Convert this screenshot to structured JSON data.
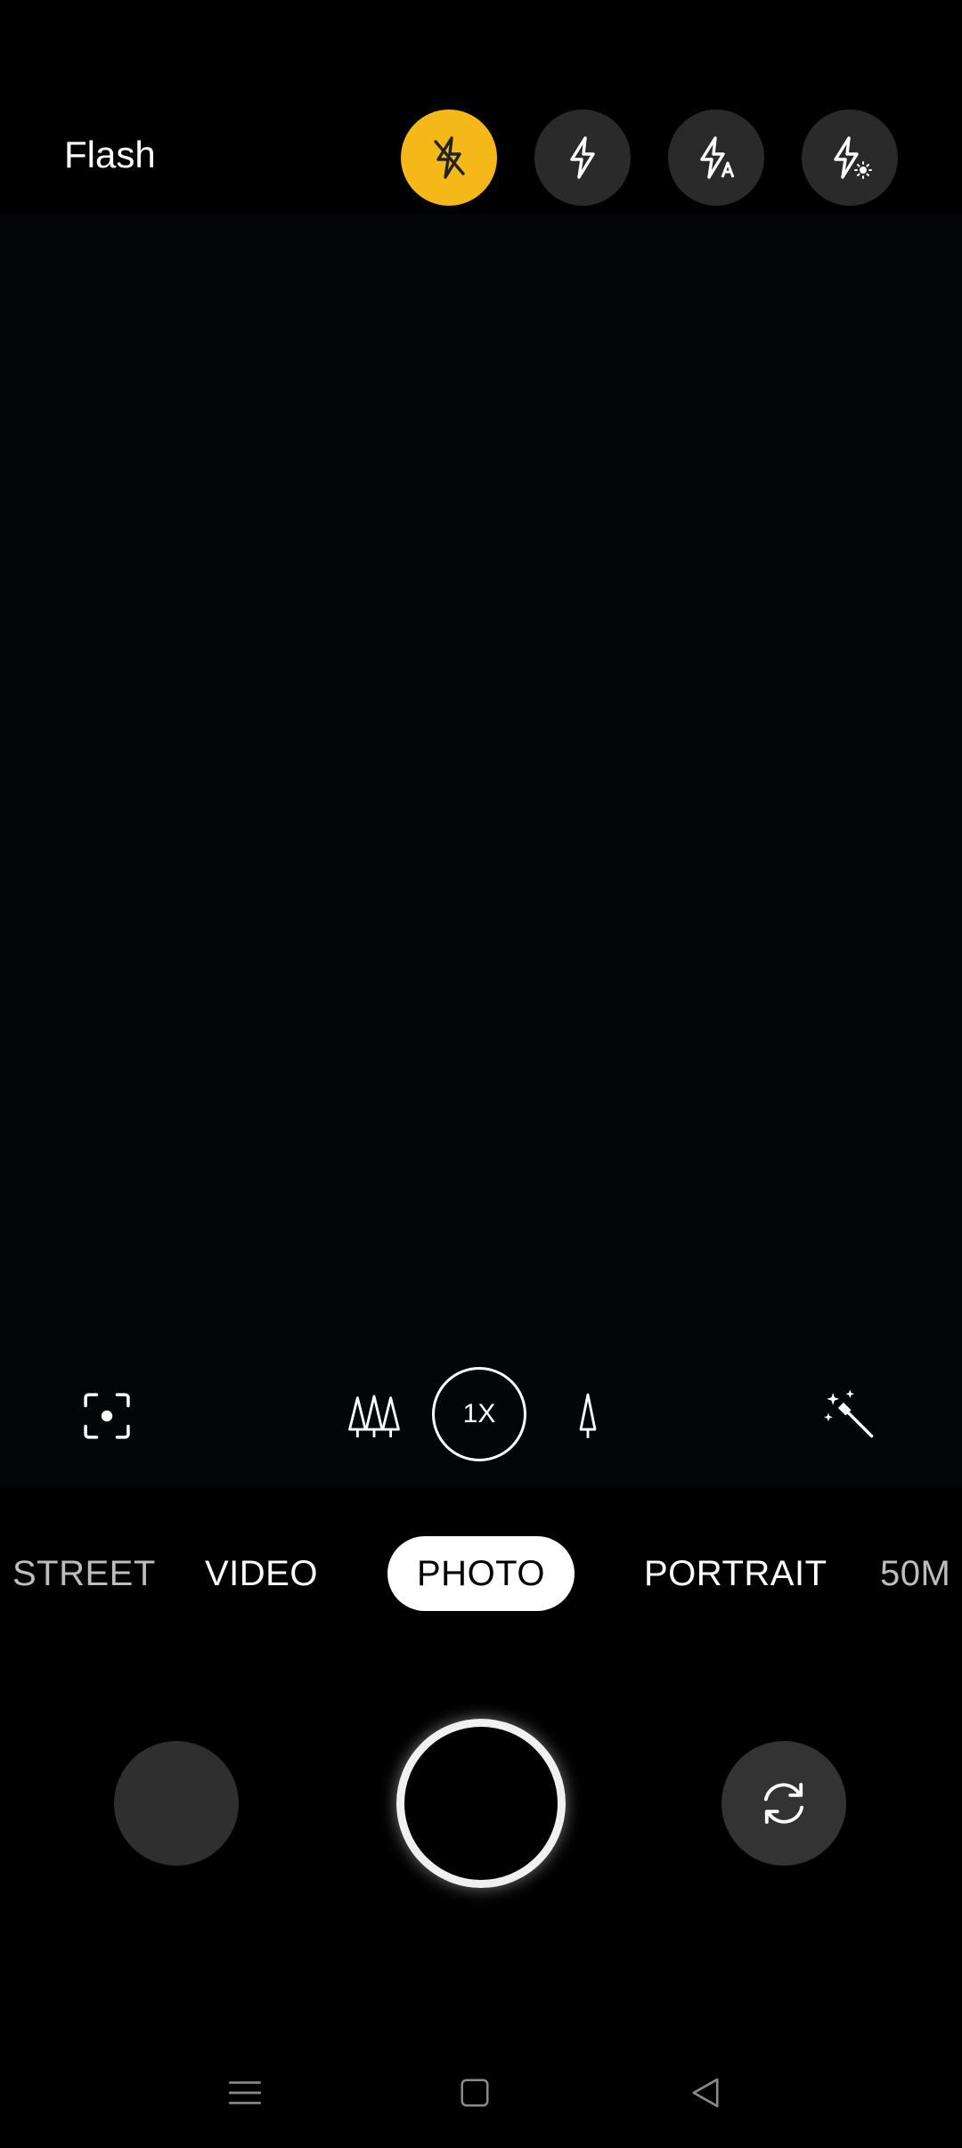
{
  "flash": {
    "label": "Flash",
    "options": [
      {
        "name": "flash-off",
        "icon": "flash-off-icon",
        "active": true
      },
      {
        "name": "flash-on",
        "icon": "flash-on-icon",
        "active": false
      },
      {
        "name": "flash-auto",
        "icon": "flash-auto-icon",
        "active": false
      },
      {
        "name": "flash-fill-light",
        "icon": "flash-fill-light-icon",
        "active": false
      }
    ],
    "active_color": "#f5b819"
  },
  "tools": {
    "zoom_label": "1X"
  },
  "modes": {
    "items": [
      "STREET",
      "VIDEO",
      "PHOTO",
      "PORTRAIT",
      "50M"
    ],
    "selected": "PHOTO"
  },
  "controls": {
    "gallery": "gallery-thumbnail",
    "shutter": "shutter",
    "switch": "switch-camera-icon"
  },
  "nav": {
    "buttons": [
      "menu-icon",
      "home-icon",
      "back-icon"
    ]
  }
}
